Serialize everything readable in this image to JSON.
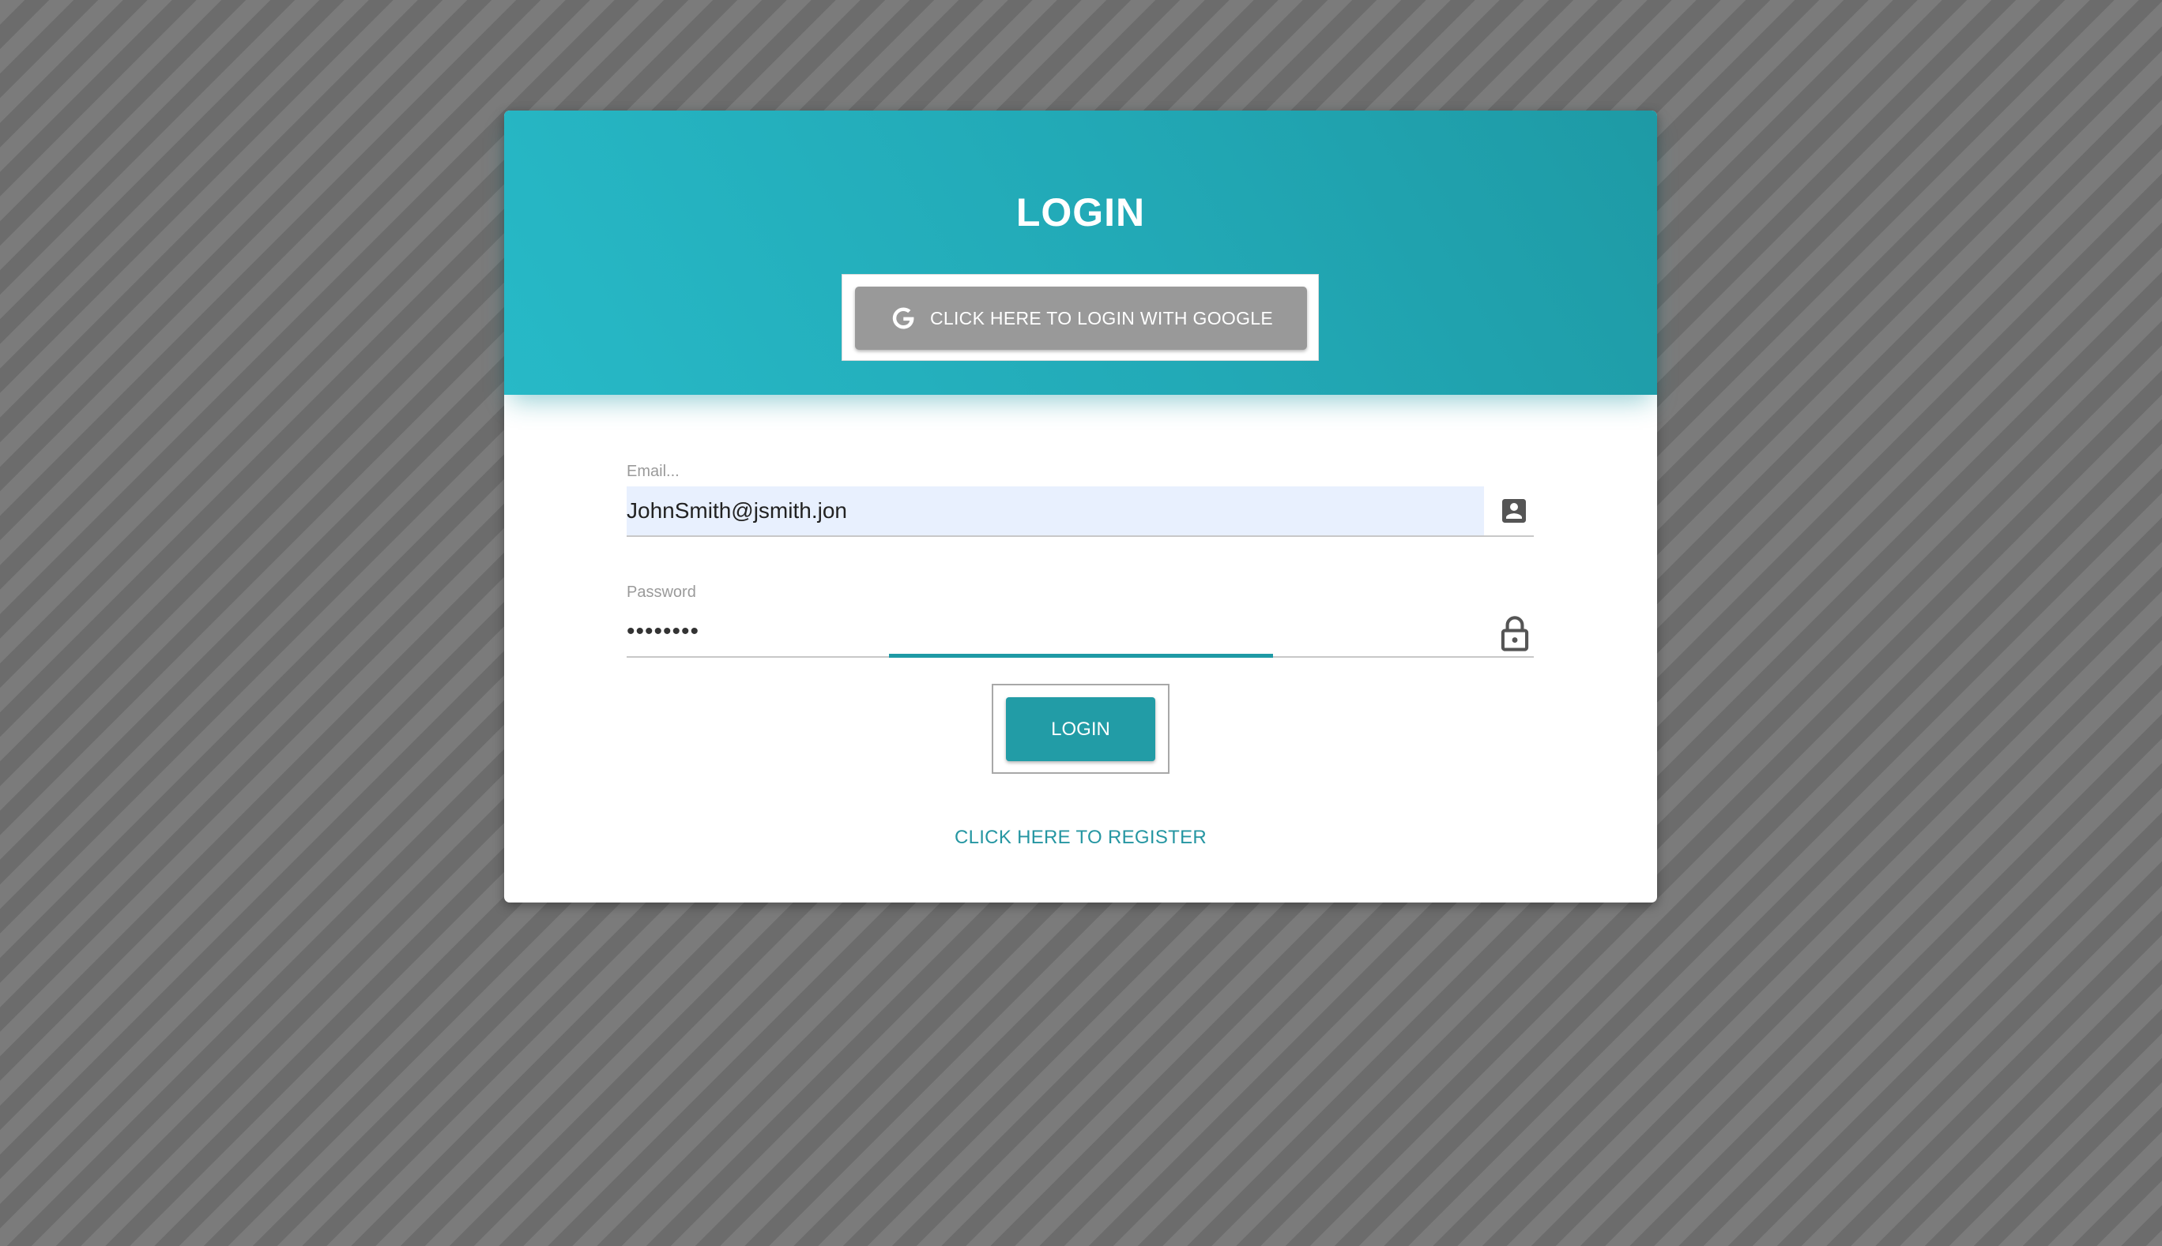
{
  "header": {
    "title": "LOGIN",
    "google_button_label": "CLICK HERE TO LOGIN WITH GOOGLE"
  },
  "form": {
    "email": {
      "label": "Email...",
      "value": "JohnSmith@jsmith.jon",
      "icon": "account-box-icon"
    },
    "password": {
      "label": "Password",
      "value": "••••••••",
      "icon": "lock-icon"
    },
    "login_button_label": "LOGIN",
    "register_link_label": "CLICK HERE TO REGISTER"
  },
  "colors": {
    "accent": "#229ca6",
    "header_gradient_start": "#27b9c7",
    "header_gradient_end": "#1e9aa5",
    "google_button": "#999999",
    "autofill_background": "#e8f0fe",
    "link": "#2596a2"
  }
}
